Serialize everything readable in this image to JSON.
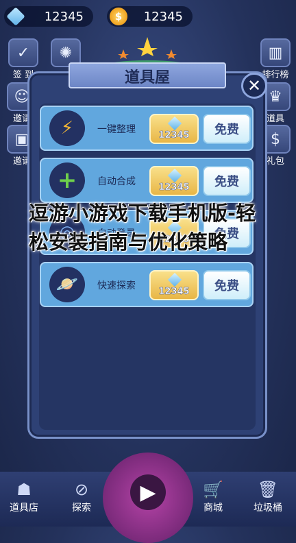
{
  "currency": {
    "gems": "12345",
    "coins": "12345"
  },
  "side_left": [
    {
      "label": "签 到",
      "icon": "calendar-icon"
    },
    {
      "label": "邀请",
      "icon": "avatar-icon"
    },
    {
      "label": "邀请",
      "icon": "gift-icon"
    }
  ],
  "side_right": [
    {
      "label": "排行榜",
      "icon": "leaderboard-icon"
    },
    {
      "label": "道具",
      "icon": "trophy-icon"
    },
    {
      "label": "礼包",
      "icon": "moneybag-icon"
    }
  ],
  "dialog": {
    "title": "道具屋",
    "close": "✕"
  },
  "items": [
    {
      "name": "一键整理",
      "price": "12345",
      "free": "免费",
      "icon": "lightning-icon"
    },
    {
      "name": "自动合成",
      "price": "12345",
      "free": "免费",
      "icon": "plus-icon"
    },
    {
      "name": "自动登录",
      "price": "12345",
      "free": "免费",
      "icon": "target-icon"
    },
    {
      "name": "快速探索",
      "price": "12345",
      "free": "免费",
      "icon": "planet-icon"
    }
  ],
  "overlay_text": "逗游小游戏下载手机版-轻松安装指南与优化策略",
  "bottom_nav": [
    {
      "label": "道具店",
      "icon": "shop-icon"
    },
    {
      "label": "探索",
      "icon": "compass-icon"
    },
    {
      "label": "商城",
      "icon": "cart-icon"
    },
    {
      "label": "垃圾桶",
      "icon": "trash-icon"
    }
  ],
  "colors": {
    "panel": "#2e4175",
    "row": "#61a7de",
    "price": "#e8b646",
    "play": "#b443a6"
  }
}
